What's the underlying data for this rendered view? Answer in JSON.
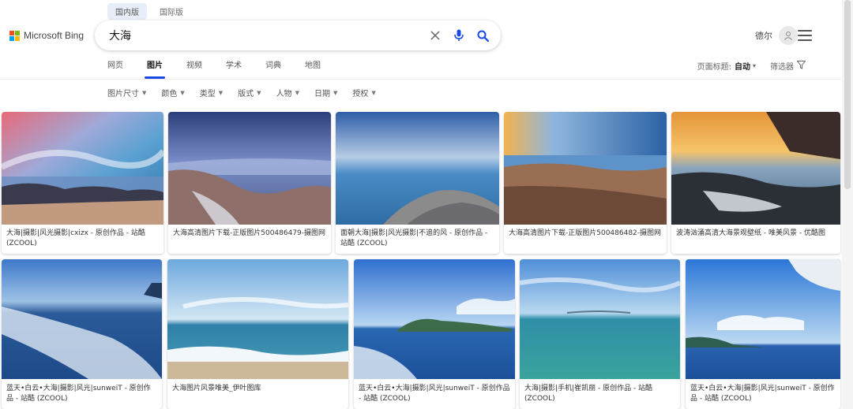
{
  "region_tabs": [
    "国内版",
    "国际版"
  ],
  "logo": {
    "text": "Microsoft Bing",
    "colors": [
      "#f25022",
      "#7fba00",
      "#00a4ef",
      "#ffb900"
    ]
  },
  "search": {
    "query": "大海",
    "clear_icon": "close-icon",
    "mic_icon": "microphone-icon",
    "search_icon": "search-icon",
    "accent": "#174ae4"
  },
  "user": {
    "name": "德尔"
  },
  "nav_tabs": [
    "网页",
    "图片",
    "视频",
    "学术",
    "词典",
    "地图"
  ],
  "active_tab": "图片",
  "nav_right": {
    "title_label": "页面标题:",
    "title_value": "自动",
    "filter_label": "筛选器"
  },
  "filters": [
    "图片尺寸",
    "颜色",
    "类型",
    "版式",
    "人物",
    "日期",
    "授权"
  ],
  "results": [
    {
      "caption": "大海|摄影|风光摄影|cxizx - 原创作品 - 站酷 (ZCOOL)"
    },
    {
      "caption": "大海高清图片下载-正版图片500486479-摄图网"
    },
    {
      "caption": "面朝大海|摄影|风光摄影|不追的风 - 原创作品 - 站酷 (ZCOOL)"
    },
    {
      "caption": "大海高清图片下载-正版图片500486482-摄图网"
    },
    {
      "caption": "波涛汹涌高清大海景观壁纸 - 唯美风景 - 优酷图"
    },
    {
      "caption": "蓝天•白云•大海|摄影|风光|sunweiT - 原创作品 - 站酷 (ZCOOL)"
    },
    {
      "caption": "大海图片风景唯美_伊叶图库"
    },
    {
      "caption": "蓝天•白云•大海|摄影|风光|sunweiT - 原创作品 - 站酷 (ZCOOL)"
    },
    {
      "caption": "大海|摄影|手机|崔凯丽 - 原创作品 - 站酷 (ZCOOL)"
    },
    {
      "caption": "蓝天•白云•大海|摄影|风光|sunweiT - 原创作品 - 站酷 (ZCOOL)"
    }
  ]
}
